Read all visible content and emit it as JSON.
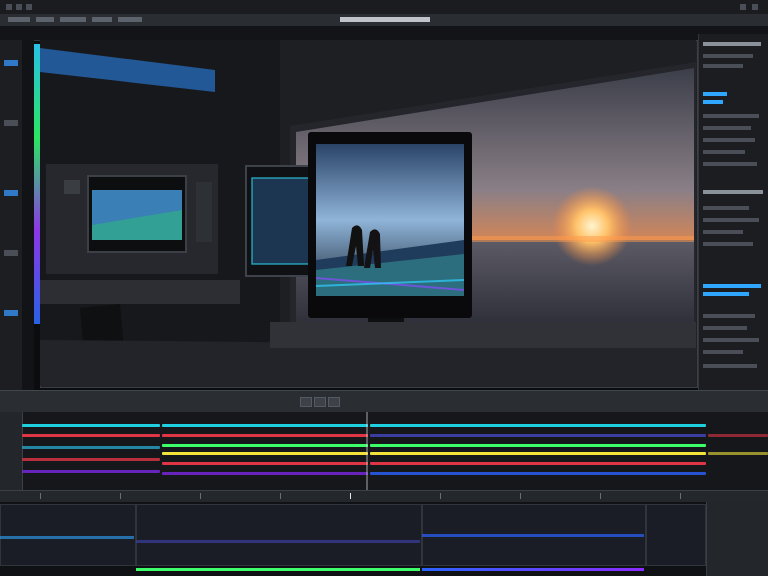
{
  "app": {
    "window_title": "",
    "viewer_caption": ""
  },
  "transport": {
    "timecode_left": "",
    "timecode_right": ""
  },
  "colors": {
    "accent_cyan": "#2fa7ff",
    "clip_teal": "#1fd0e0",
    "clip_red": "#e03545",
    "clip_green": "#3cff6a",
    "clip_yellow": "#f2e23a",
    "clip_purple": "#8a2bff",
    "clip_blue": "#2b63ff",
    "sunset_orange": "#ff8a3d"
  },
  "icons": [
    "playhead-marker-icon",
    "play-icon",
    "stop-icon",
    "loop-icon"
  ]
}
